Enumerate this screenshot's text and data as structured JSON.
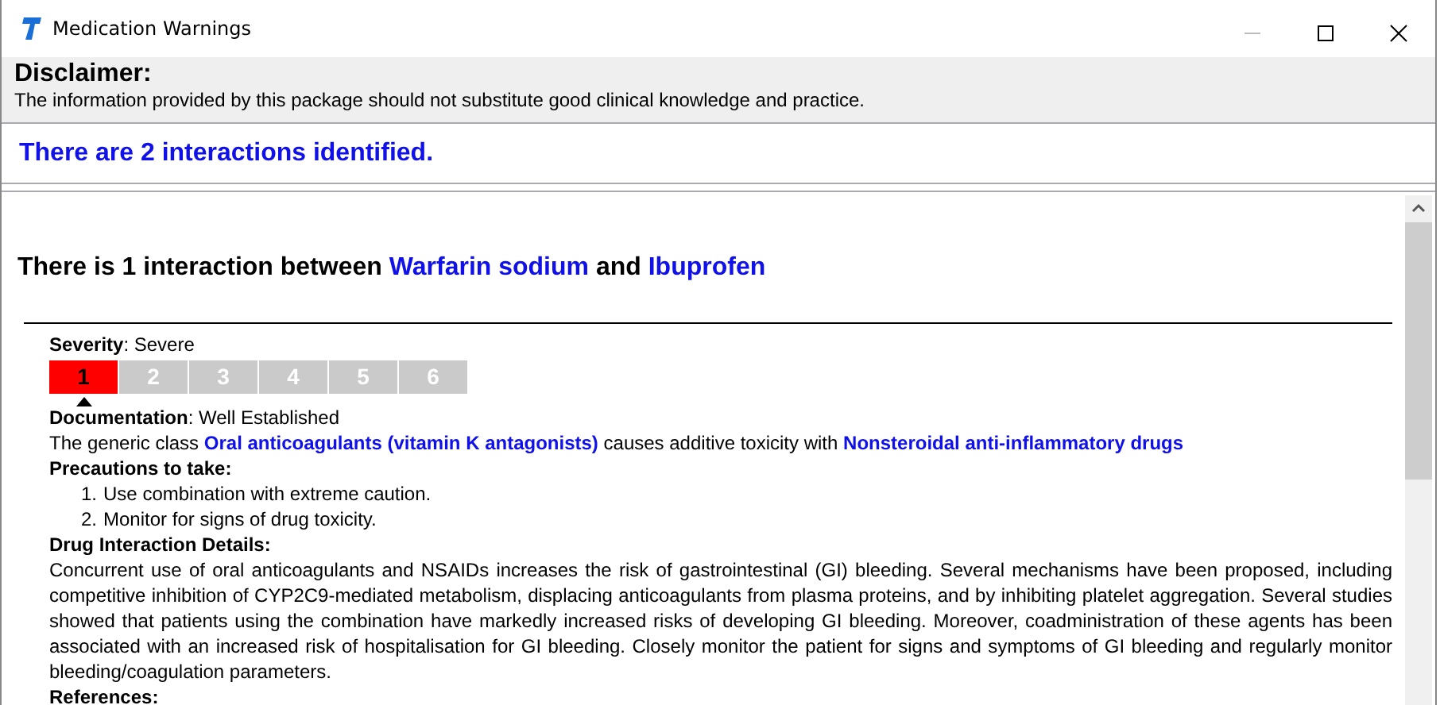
{
  "window": {
    "title": "Medication Warnings"
  },
  "disclaimer": {
    "heading": "Disclaimer:",
    "text": "The information provided by this package should not substitute good clinical knowledge and practice."
  },
  "summary": "There are 2 interactions identified.",
  "interaction": {
    "heading": [
      {
        "kind": "plain",
        "text": "There is 1 interaction between"
      },
      {
        "kind": "drug",
        "text": "Warfarin sodium"
      },
      {
        "kind": "plain",
        "text": "and"
      },
      {
        "kind": "drug",
        "text": "Ibuprofen"
      }
    ],
    "severity": {
      "text": "**Severity**: Severe",
      "scale": [
        {
          "label": "1",
          "selected": true
        },
        {
          "label": "2",
          "selected": false
        },
        {
          "label": "3",
          "selected": false
        },
        {
          "label": "4",
          "selected": false
        },
        {
          "label": "5",
          "selected": false
        },
        {
          "label": "6",
          "selected": false
        }
      ]
    },
    "documentation": {
      "text": "**Documentation**: Well Established"
    },
    "description": [
      {
        "kind": "plain",
        "text": "The generic class"
      },
      {
        "kind": "class",
        "text": "Oral anticoagulants (vitamin K antagonists)"
      },
      {
        "kind": "plain",
        "text": "causes additive toxicity with"
      },
      {
        "kind": "class",
        "text": "Nonsteroidal anti-inflammatory drugs"
      }
    ],
    "precautions": {
      "heading": "Precautions to take:",
      "items": [
        {
          "number": "1.",
          "text": "Use combination with extreme caution."
        },
        {
          "number": "2.",
          "text": "Monitor for signs of drug toxicity."
        }
      ]
    },
    "details": {
      "heading": "Drug Interaction Details:",
      "text": "Concurrent use of oral anticoagulants and NSAIDs increases the risk of gastrointestinal (GI) bleeding. Several mechanisms have been proposed, including competitive inhibition of CYP2C9-mediated metabolism, displacing anticoagulants from plasma proteins, and by inhibiting platelet aggregation. Several studies showed that patients using the combination have markedly increased risks of developing GI bleeding. Moreover, coadministration of these agents has been associated with an increased risk of hospitalisation for GI bleeding. Closely monitor the patient for signs and symptoms of GI bleeding and regularly monitor bleeding/coagulation parameters."
    },
    "references": {
      "heading": "References:"
    }
  }
}
